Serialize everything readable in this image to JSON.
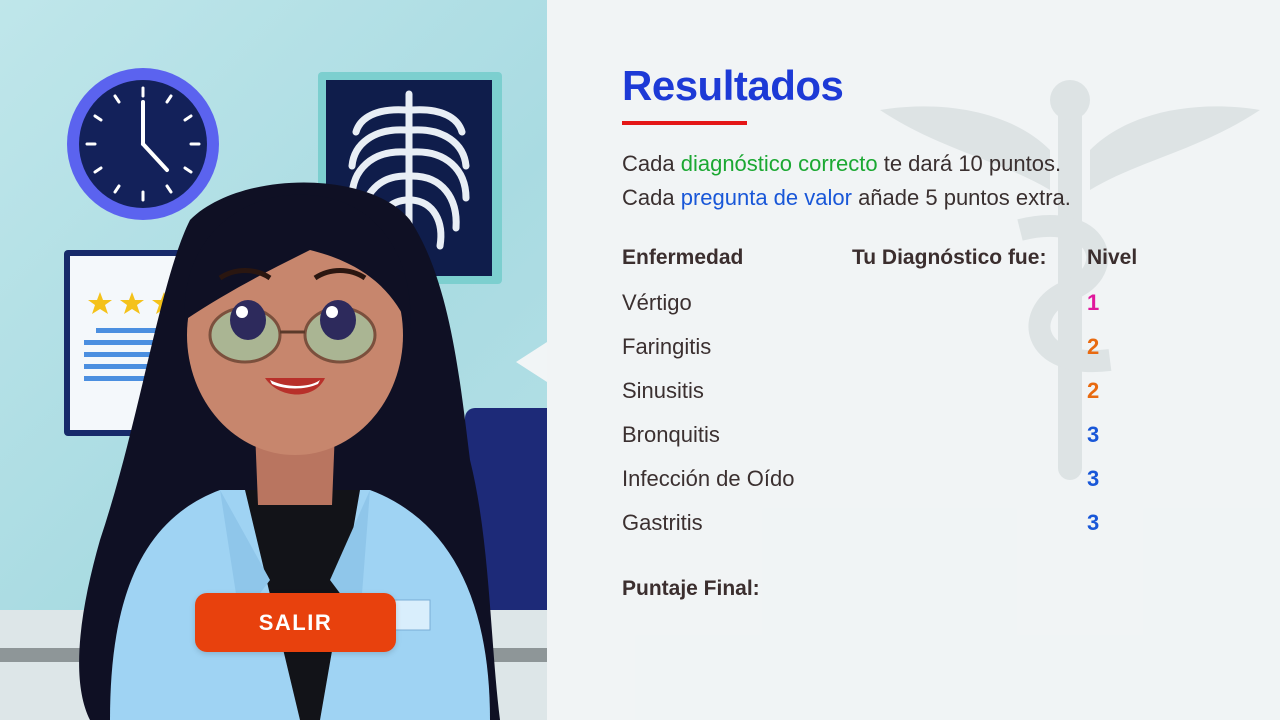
{
  "results": {
    "title": "Resultados",
    "intro_line1": {
      "prefix": "Cada ",
      "highlight": "diagnóstico correcto",
      "suffix": " te dará 10 puntos."
    },
    "intro_line2": {
      "prefix": "Cada ",
      "highlight": "pregunta de valor",
      "suffix": " añade 5 puntos extra."
    },
    "table": {
      "headers": {
        "disease": "Enfermedad",
        "diagnosis": "Tu Diagnóstico fue:",
        "level": "Nivel"
      },
      "rows": [
        {
          "disease": "Vértigo",
          "level": "1",
          "level_color": "#e0189c"
        },
        {
          "disease": "Faringitis",
          "level": "2",
          "level_color": "#e86a10"
        },
        {
          "disease": "Sinusitis",
          "level": "2",
          "level_color": "#e86a10"
        },
        {
          "disease": "Bronquitis",
          "level": "3",
          "level_color": "#1957d8"
        },
        {
          "disease": "Infección de Oído",
          "level": "3",
          "level_color": "#1957d8"
        },
        {
          "disease": "Gastritis",
          "level": "3",
          "level_color": "#1957d8"
        }
      ]
    },
    "final_score_label": "Puntaje Final:"
  },
  "actions": {
    "exit_label": "SALIR"
  },
  "colors": {
    "title": "#1d3ad6",
    "underline": "#e41616",
    "highlight_green": "#1ba832",
    "highlight_blue": "#1957d8",
    "exit_button": "#e8410d"
  }
}
